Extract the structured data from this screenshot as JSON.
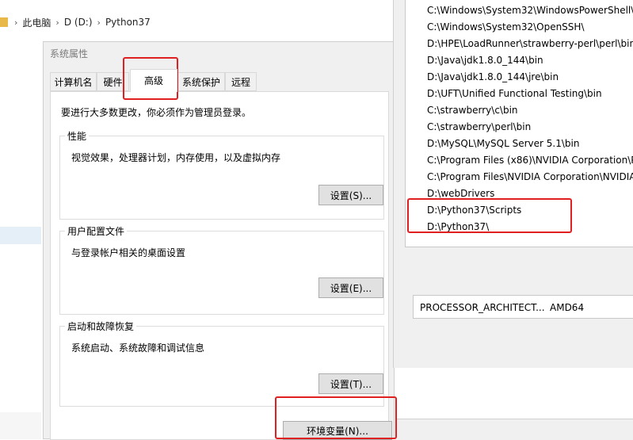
{
  "explorer": {
    "breadcrumb": [
      "此电脑",
      "D (D:)",
      "Python37"
    ],
    "separator": "›"
  },
  "system_properties": {
    "title": "系统属性",
    "tabs": [
      "计算机名",
      "硬件",
      "高级",
      "系统保护",
      "远程"
    ],
    "active_tab": "高级",
    "admin_note": "要进行大多数更改，你必须作为管理员登录。",
    "performance": {
      "title": "性能",
      "description": "视觉效果，处理器计划，内存使用，以及虚拟内存",
      "button": "设置(S)..."
    },
    "user_profiles": {
      "title": "用户配置文件",
      "description": "与登录帐户相关的桌面设置",
      "button": "设置(E)..."
    },
    "startup_recovery": {
      "title": "启动和故障恢复",
      "description": "系统启动、系统故障和调试信息",
      "button": "设置(T)..."
    },
    "env_button": "环境变量(N)..."
  },
  "edit_env": {
    "paths": [
      "C:\\Windows\\System32\\WindowsPowerShell\\v",
      "C:\\Windows\\System32\\OpenSSH\\",
      "D:\\HPE\\LoadRunner\\strawberry-perl\\perl\\bin",
      "D:\\Java\\jdk1.8.0_144\\bin",
      "D:\\Java\\jdk1.8.0_144\\jre\\bin",
      "D:\\UFT\\Unified Functional Testing\\bin",
      "C:\\strawberry\\c\\bin",
      "C:\\strawberry\\perl\\bin",
      "D:\\MySQL\\MySQL Server 5.1\\bin",
      "C:\\Program Files (x86)\\NVIDIA Corporation\\P",
      "C:\\Program Files\\NVIDIA Corporation\\NVIDIA",
      "D:\\webDrivers",
      "D:\\Python37\\Scripts",
      "D:\\Python37\\"
    ]
  },
  "system_variables": {
    "row": {
      "name": "PROCESSOR_ARCHITECT...",
      "value": "AMD64"
    }
  },
  "colors": {
    "highlight": "#e02020",
    "dialog_bg": "#f0f0f0",
    "button_bg": "#e1e1e1"
  }
}
